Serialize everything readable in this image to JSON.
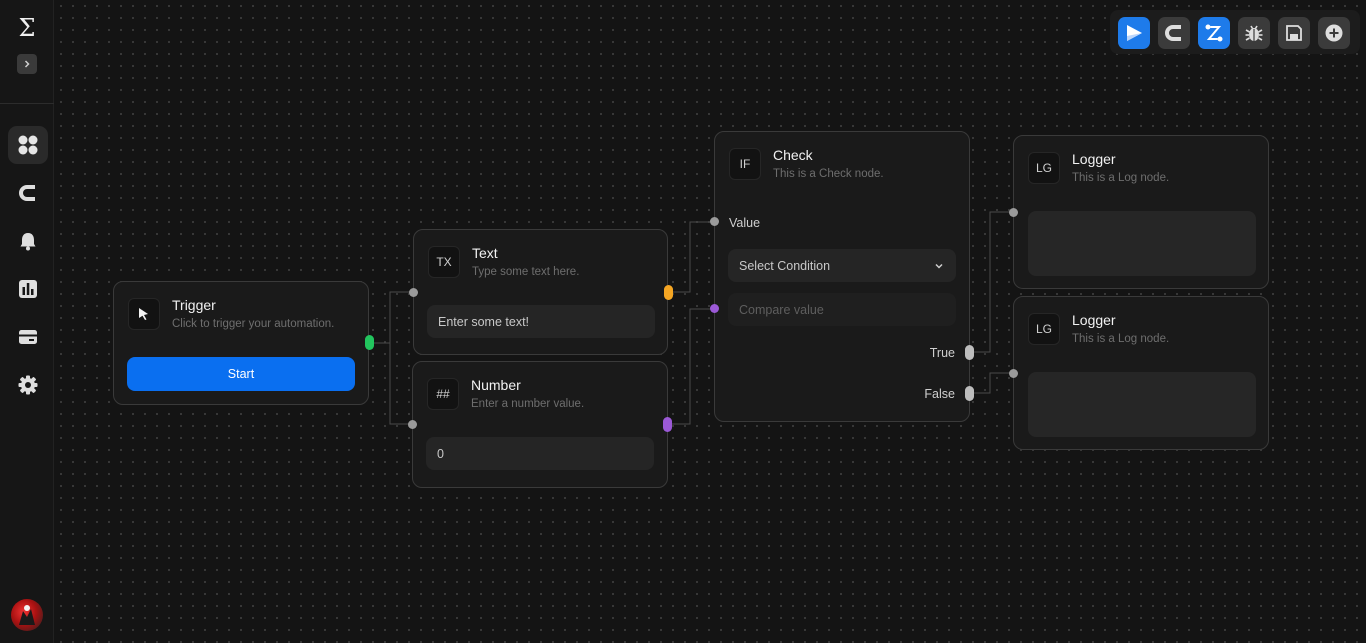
{
  "app": {
    "logo": "Σ"
  },
  "sidebar": {
    "items": [
      {
        "name": "dashboard-icon",
        "active": true
      },
      {
        "name": "magnet-icon",
        "active": false
      },
      {
        "name": "bell-icon",
        "active": false
      },
      {
        "name": "chart-icon",
        "active": false
      },
      {
        "name": "card-icon",
        "active": false
      },
      {
        "name": "gear-icon",
        "active": false
      }
    ]
  },
  "toolbar": {
    "buttons": [
      {
        "name": "run-icon",
        "color": "#1e7bea"
      },
      {
        "name": "magnet-icon",
        "color": "#3b3b3b"
      },
      {
        "name": "connect-icon",
        "color": "#1e7bea"
      },
      {
        "name": "debug-icon",
        "color": "#3b3b3b"
      },
      {
        "name": "save-icon",
        "color": "#3b3b3b"
      },
      {
        "name": "add-icon",
        "color": "#3b3b3b"
      }
    ]
  },
  "nodes": {
    "trigger": {
      "title": "Trigger",
      "subtitle": "Click to trigger your automation.",
      "button": "Start"
    },
    "text": {
      "icon": "TX",
      "title": "Text",
      "subtitle": "Type some text here.",
      "input_placeholder": "Enter some text!"
    },
    "number": {
      "icon": "##",
      "title": "Number",
      "subtitle": "Enter a number value.",
      "input_value": "0"
    },
    "check": {
      "icon": "IF",
      "title": "Check",
      "subtitle": "This is a Check node.",
      "value_label": "Value",
      "condition_select": "Select Condition",
      "compare_placeholder": "Compare value",
      "true_label": "True",
      "false_label": "False"
    },
    "logger1": {
      "icon": "LG",
      "title": "Logger",
      "subtitle": "This is a Log node."
    },
    "logger2": {
      "icon": "LG",
      "title": "Logger",
      "subtitle": "This is a Log node."
    }
  },
  "colors": {
    "accent": "#0a6ff0",
    "port_trigger": "#22c55e",
    "port_text": "#f5a623",
    "port_number": "#9b59d6",
    "port_check": "#bdbdbd"
  }
}
